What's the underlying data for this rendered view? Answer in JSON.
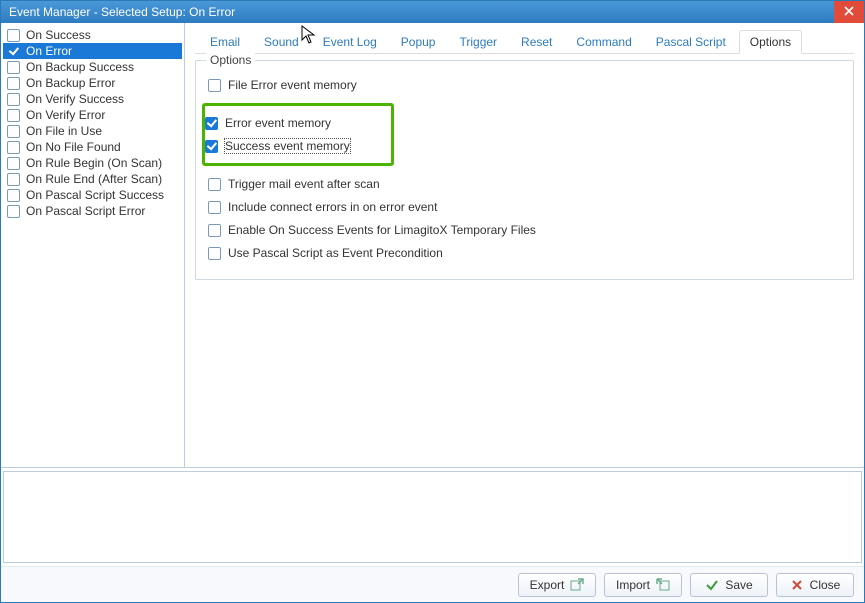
{
  "window": {
    "title": "Event Manager - Selected Setup: On Error"
  },
  "sidebar": {
    "items": [
      {
        "label": "On Success",
        "checked": false,
        "selected": false
      },
      {
        "label": "On Error",
        "checked": true,
        "selected": true
      },
      {
        "label": "On Backup Success",
        "checked": false,
        "selected": false
      },
      {
        "label": "On Backup Error",
        "checked": false,
        "selected": false
      },
      {
        "label": "On Verify Success",
        "checked": false,
        "selected": false
      },
      {
        "label": "On Verify Error",
        "checked": false,
        "selected": false
      },
      {
        "label": "On File in Use",
        "checked": false,
        "selected": false
      },
      {
        "label": "On No File Found",
        "checked": false,
        "selected": false
      },
      {
        "label": "On Rule Begin (On Scan)",
        "checked": false,
        "selected": false
      },
      {
        "label": "On Rule End (After Scan)",
        "checked": false,
        "selected": false
      },
      {
        "label": "On Pascal Script Success",
        "checked": false,
        "selected": false
      },
      {
        "label": "On Pascal Script Error",
        "checked": false,
        "selected": false
      }
    ]
  },
  "tabs": {
    "items": [
      {
        "label": "Email",
        "active": false
      },
      {
        "label": "Sound",
        "active": false
      },
      {
        "label": "Event Log",
        "active": false
      },
      {
        "label": "Popup",
        "active": false
      },
      {
        "label": "Trigger",
        "active": false
      },
      {
        "label": "Reset",
        "active": false
      },
      {
        "label": "Command",
        "active": false
      },
      {
        "label": "Pascal Script",
        "active": false
      },
      {
        "label": "Options",
        "active": true
      }
    ]
  },
  "options_group": {
    "legend": "Options",
    "highlighted": [
      1,
      2
    ],
    "items": [
      {
        "label": "File Error event memory",
        "checked": false
      },
      {
        "label": "Error event memory",
        "checked": true
      },
      {
        "label": "Success event memory",
        "checked": true,
        "focused": true
      },
      {
        "label": "Trigger mail event after scan",
        "checked": false
      },
      {
        "label": "Include connect errors in on error event",
        "checked": false
      },
      {
        "label": "Enable On Success Events for LimagitoX Temporary Files",
        "checked": false
      },
      {
        "label": "Use Pascal Script as Event Precondition",
        "checked": false
      }
    ]
  },
  "buttons": {
    "export": "Export",
    "import": "Import",
    "save": "Save",
    "close": "Close"
  },
  "colors": {
    "accent": "#1a78d6",
    "highlight": "#4bb400",
    "titlebar": "#2d7cc0",
    "close_button": "#e04b3a"
  }
}
